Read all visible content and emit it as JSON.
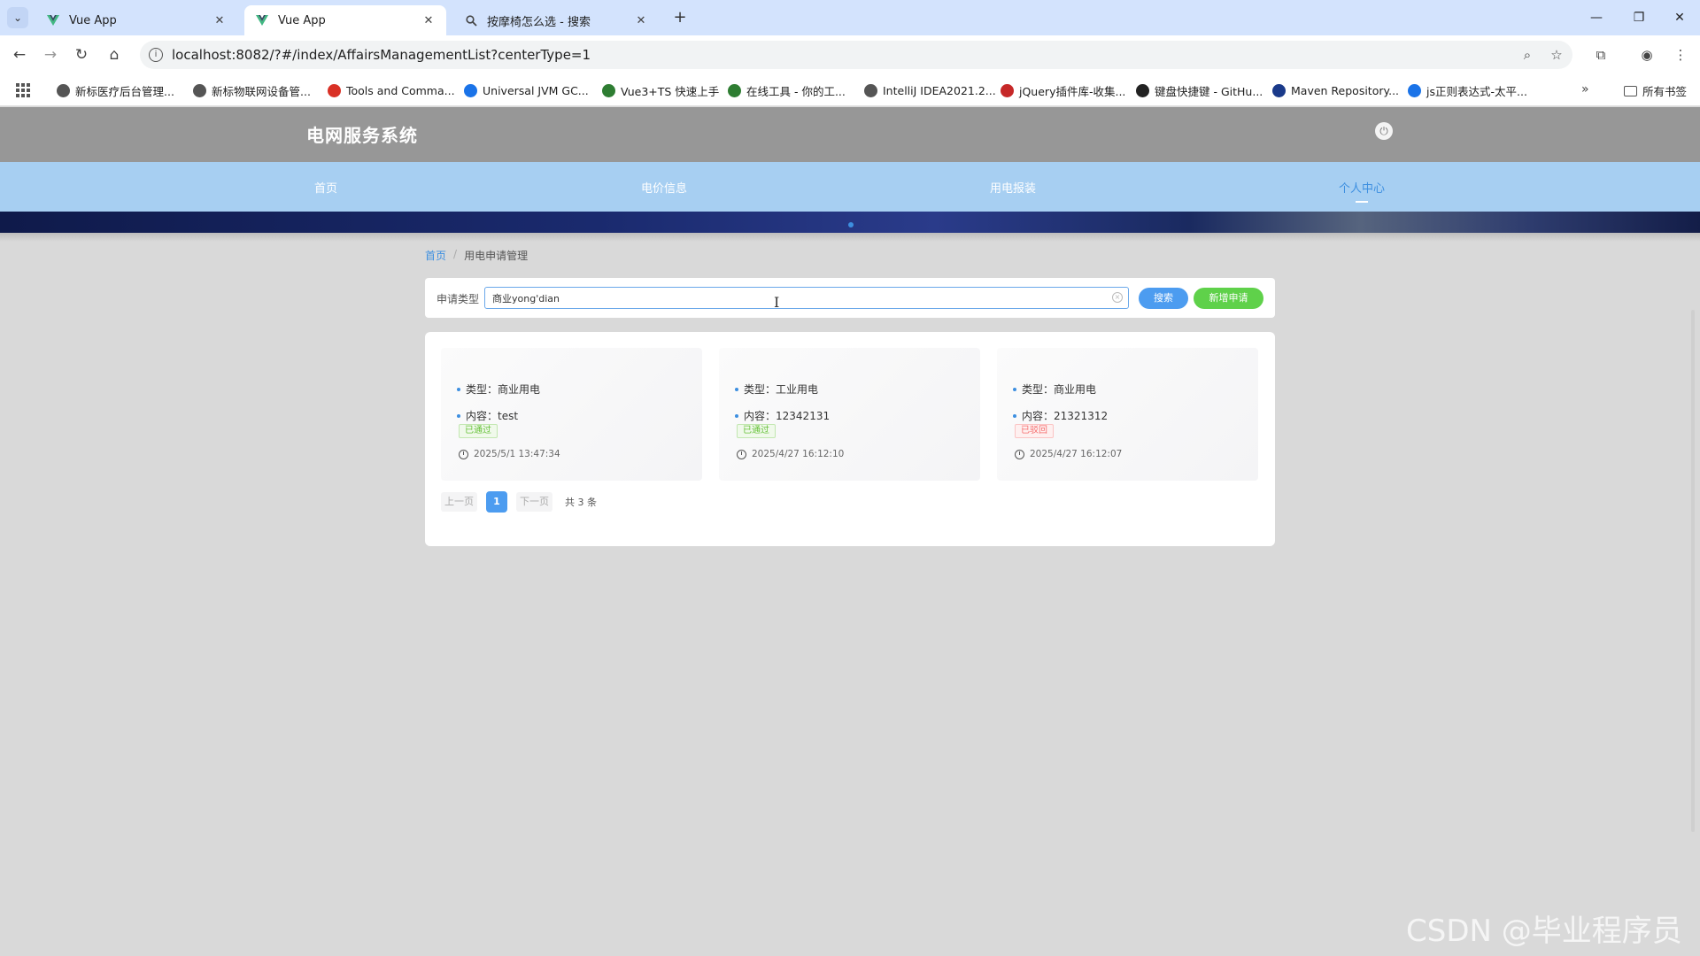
{
  "browser": {
    "tabs": [
      {
        "title": "Vue App",
        "icon": "vue-icon",
        "active": false
      },
      {
        "title": "Vue App",
        "icon": "vue-icon",
        "active": true
      },
      {
        "title": "按摩椅怎么选 - 搜索",
        "icon": "search-icon",
        "active": false
      }
    ],
    "url": "localhost:8082/?#/index/AffairsManagementList?centerType=1",
    "bookmarks": [
      {
        "label": "新标医疗后台管理...",
        "color": "#555555"
      },
      {
        "label": "新标物联网设备管...",
        "color": "#555555"
      },
      {
        "label": "Tools and Comma...",
        "color": "#d93025"
      },
      {
        "label": "Universal JVM GC...",
        "color": "#1a73e8"
      },
      {
        "label": "Vue3+TS 快速上手",
        "color": "#2e7d32"
      },
      {
        "label": "在线工具 - 你的工...",
        "color": "#2e7d32"
      },
      {
        "label": "IntelliJ IDEA2021.2...",
        "color": "#555555"
      },
      {
        "label": "jQuery插件库-收集...",
        "color": "#c62828"
      },
      {
        "label": "键盘快捷键 - GitHu...",
        "color": "#222222"
      },
      {
        "label": "Maven Repository...",
        "color": "#1a3a8a"
      },
      {
        "label": "js正则表达式-太平...",
        "color": "#1a73e8"
      }
    ],
    "all_bookmarks_label": "所有书签"
  },
  "app": {
    "title": "电网服务系统",
    "nav": [
      {
        "label": "首页",
        "active": false
      },
      {
        "label": "电价信息",
        "active": false
      },
      {
        "label": "用电报装",
        "active": false
      },
      {
        "label": "个人中心",
        "active": true
      }
    ],
    "breadcrumb": {
      "home": "首页",
      "separator": "/",
      "current": "用电申请管理"
    },
    "search": {
      "label": "申请类型",
      "value": "商业yong'dian",
      "search_button": "搜索",
      "add_button": "新增申请"
    },
    "records": [
      {
        "type_label": "类型：",
        "type": "商业用电",
        "content_label": "内容：",
        "content": "test",
        "status": "已通过",
        "status_kind": "approved",
        "time": "2025/5/1 13:47:34"
      },
      {
        "type_label": "类型：",
        "type": "工业用电",
        "content_label": "内容：",
        "content": "12342131",
        "status": "已通过",
        "status_kind": "approved",
        "time": "2025/4/27 16:12:10"
      },
      {
        "type_label": "类型：",
        "type": "商业用电",
        "content_label": "内容：",
        "content": "21321312",
        "status": "已驳回",
        "status_kind": "rejected",
        "time": "2025/4/27 16:12:07"
      }
    ],
    "pagination": {
      "prev": "上一页",
      "current": "1",
      "next": "下一页",
      "total": "共 3 条"
    }
  },
  "watermark": "CSDN @毕业程序员",
  "colors": {
    "accent": "#3d8fe0",
    "nav_bg": "#a7cff2",
    "header_bg": "#979797",
    "approved": "#67c23a",
    "rejected": "#f56c6c",
    "add_button": "#5fd14a"
  }
}
